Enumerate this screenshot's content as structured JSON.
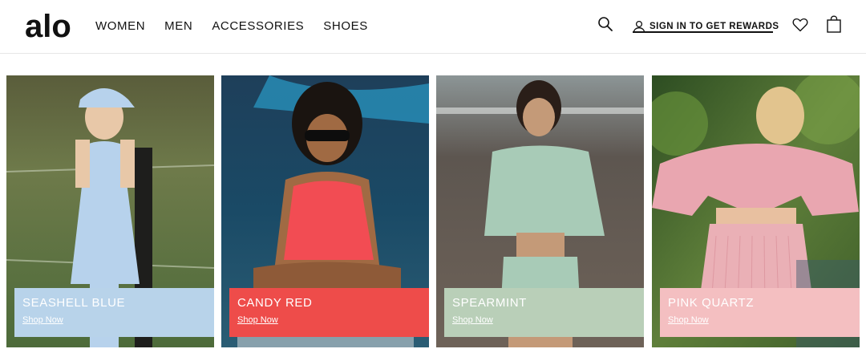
{
  "header": {
    "logo": "alo",
    "nav": [
      "WOMEN",
      "MEN",
      "ACCESSORIES",
      "SHOES"
    ],
    "rewards_label": "SIGN IN TO GET REWARDS",
    "icons": [
      "search-icon",
      "user-icon",
      "heart-icon",
      "shopping-bag-icon"
    ]
  },
  "tiles": [
    {
      "name": "SEASHELL BLUE",
      "cta": "Shop Now",
      "caption_color": "#b8d3ea"
    },
    {
      "name": "CANDY RED",
      "cta": "Shop Now",
      "caption_color": "#ee4c4a"
    },
    {
      "name": "SPEARMINT",
      "cta": "Shop Now",
      "caption_color": "#b9cfb8"
    },
    {
      "name": "PINK QUARTZ",
      "cta": "Shop Now",
      "caption_color": "#f4bfc1"
    }
  ]
}
